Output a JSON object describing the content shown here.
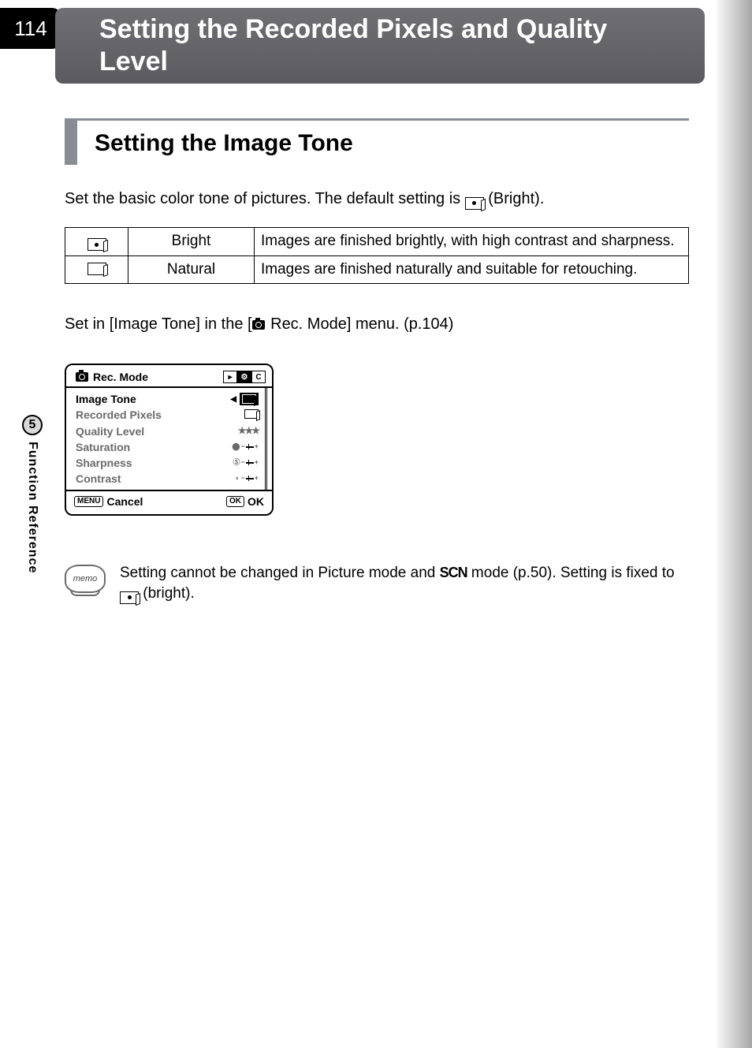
{
  "page_number": "114",
  "header_title": "Setting the Recorded Pixels and Quality Level",
  "section_heading": "Setting the Image Tone",
  "intro_prefix": "Set the basic color tone of pictures. The default setting is ",
  "intro_suffix": " (Bright).",
  "table": {
    "rows": [
      {
        "icon": "bright-tone-icon",
        "label": "Bright",
        "desc": "Images are finished brightly, with high contrast and sharpness."
      },
      {
        "icon": "natural-tone-icon",
        "label": "Natural",
        "desc": "Images are finished naturally and suitable for retouching."
      }
    ]
  },
  "setin_prefix": "Set in [Image Tone] in the [",
  "setin_suffix": " Rec. Mode] menu. (p.104)",
  "menu": {
    "title": "Rec. Mode",
    "items": [
      {
        "label": "Image Tone",
        "value_kind": "bright-selector",
        "highlight": true
      },
      {
        "label": "Recorded Pixels",
        "value_kind": "natural-mini"
      },
      {
        "label": "Quality Level",
        "value_kind": "stars",
        "value_text": "★★★"
      },
      {
        "label": "Saturation",
        "value_kind": "slider",
        "value_left": "⬤"
      },
      {
        "label": "Sharpness",
        "value_kind": "slider",
        "value_left": "Ⓢ"
      },
      {
        "label": "Contrast",
        "value_kind": "slider",
        "value_left": "◐"
      }
    ],
    "footer_left_key": "MENU",
    "footer_left_label": "Cancel",
    "footer_right_key": "OK",
    "footer_right_label": "OK"
  },
  "memo": {
    "badge": "memo",
    "text_1": "Setting cannot be changed in Picture mode and ",
    "scn": "SCN",
    "text_2": " mode (p.50). Setting is fixed to ",
    "text_3": " (bright)."
  },
  "side_tab": {
    "number": "5",
    "label": "Function Reference"
  }
}
